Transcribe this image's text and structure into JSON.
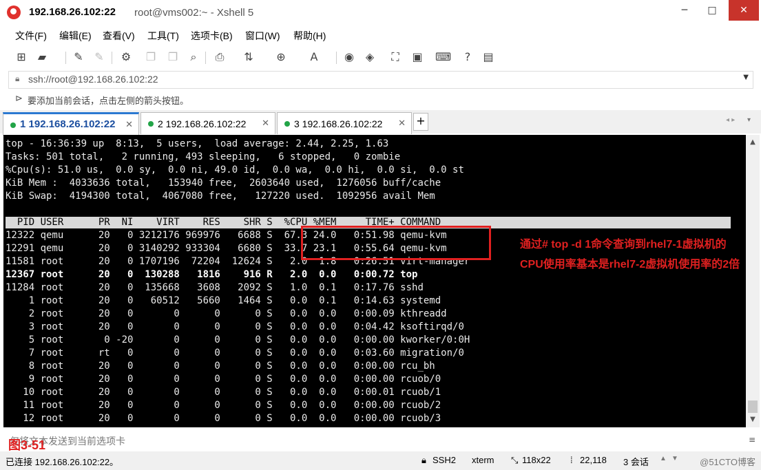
{
  "window": {
    "title_main": "192.168.26.102:22",
    "title_sub": "root@vms002:~ - Xshell 5",
    "min": "─",
    "max": "□",
    "close": "✕"
  },
  "menu": [
    "文件(F)",
    "编辑(E)",
    "查看(V)",
    "工具(T)",
    "选项卡(B)",
    "窗口(W)",
    "帮助(H)"
  ],
  "address": {
    "value": "ssh://root@192.168.26.102:22"
  },
  "hint": "要添加当前会话，点击左侧的箭头按钮。",
  "tabs": [
    {
      "label": "1 192.168.26.102:22",
      "active": true
    },
    {
      "label": "2 192.168.26.102:22",
      "active": false
    },
    {
      "label": "3 192.168.26.102:22",
      "active": false
    }
  ],
  "terminal": {
    "summary": [
      "top - 16:36:39 up  8:13,  5 users,  load average: 2.44, 2.25, 1.63",
      "Tasks: 501 total,   2 running, 493 sleeping,   6 stopped,   0 zombie",
      "%Cpu(s): 51.0 us,  0.0 sy,  0.0 ni, 49.0 id,  0.0 wa,  0.0 hi,  0.0 si,  0.0 st",
      "KiB Mem :  4033636 total,   153940 free,  2603640 used,  1276056 buff/cache",
      "KiB Swap:  4194300 total,  4067080 free,   127220 used.  1092956 avail Mem"
    ],
    "header": "  PID USER      PR  NI    VIRT    RES    SHR S  %CPU %MEM     TIME+ COMMAND",
    "rows": [
      "12322 qemu      20   0 3212176 969976   6688 S  67.3 24.0   0:51.98 qemu-kvm",
      "12291 qemu      20   0 3140292 933304   6680 S  33.7 23.1   0:55.64 qemu-kvm",
      "11581 root      20   0 1707196  72204  12624 S   2.0  1.8   0:26.51 virt-manager",
      "12367 root      20   0  130288   1816    916 R   2.0  0.0   0:00.72 top",
      "11284 root      20   0  135668   3608   2092 S   1.0  0.1   0:17.76 sshd",
      "    1 root      20   0   60512   5660   1464 S   0.0  0.1   0:14.63 systemd",
      "    2 root      20   0       0      0      0 S   0.0  0.0   0:00.09 kthreadd",
      "    3 root      20   0       0      0      0 S   0.0  0.0   0:04.42 ksoftirqd/0",
      "    5 root       0 -20       0      0      0 S   0.0  0.0   0:00.00 kworker/0:0H",
      "    7 root      rt   0       0      0      0 S   0.0  0.0   0:03.60 migration/0",
      "    8 root      20   0       0      0      0 S   0.0  0.0   0:00.00 rcu_bh",
      "    9 root      20   0       0      0      0 S   0.0  0.0   0:00.00 rcuob/0",
      "   10 root      20   0       0      0      0 S   0.0  0.0   0:00.01 rcuob/1",
      "   11 root      20   0       0      0      0 S   0.0  0.0   0:00.00 rcuob/2",
      "   12 root      20   0       0      0      0 S   0.0  0.0   0:00.00 rcuob/3"
    ]
  },
  "annotation": "通过# top -d 1命令查询到rhel7-1虚拟机的CPU使用率基本是rhel7-2虚拟机使用率的2倍",
  "input_placeholder": "仅将文本发送到当前选项卡",
  "figure_label": "图3-51",
  "status": {
    "connection": "已连接 192.168.26.102:22。",
    "protocol": "SSH2",
    "term": "xterm",
    "size": "118x22",
    "cursor": "22,118",
    "sessions": "3 会话",
    "watermark": "@51CTO博客"
  },
  "colors": {
    "accent": "#2b79d1",
    "annotation": "#e02020",
    "terminal_bg": "#000000",
    "terminal_fg": "#eaeaea",
    "status_green": "#22a447"
  }
}
